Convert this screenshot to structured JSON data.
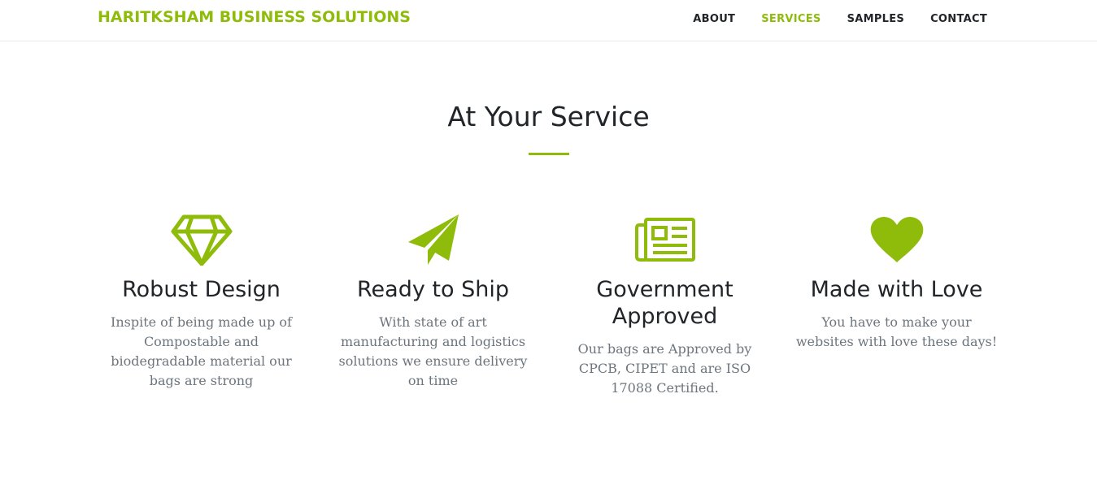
{
  "colors": {
    "accent": "#8fbc0a",
    "text": "#212529",
    "muted": "#6c757d"
  },
  "navbar": {
    "brand": "HARITKSHAM BUSINESS SOLUTIONS",
    "links": [
      {
        "label": "ABOUT",
        "active": false
      },
      {
        "label": "SERVICES",
        "active": true
      },
      {
        "label": "SAMPLES",
        "active": false
      },
      {
        "label": "CONTACT",
        "active": false
      }
    ]
  },
  "section": {
    "title": "At Your Service",
    "services": [
      {
        "icon": "diamond-icon",
        "title": "Robust Design",
        "text": "Inspite of being made up of Compostable and biodegradable material our bags are strong"
      },
      {
        "icon": "paper-plane-icon",
        "title": "Ready to Ship",
        "text": "With state of art manufacturing and logistics solutions we ensure delivery on time"
      },
      {
        "icon": "newspaper-icon",
        "title": "Government Approved",
        "text": "Our bags are Approved by CPCB, CIPET and are ISO 17088 Certified."
      },
      {
        "icon": "heart-icon",
        "title": "Made with Love",
        "text": "You have to make your websites with love these days!"
      }
    ]
  }
}
